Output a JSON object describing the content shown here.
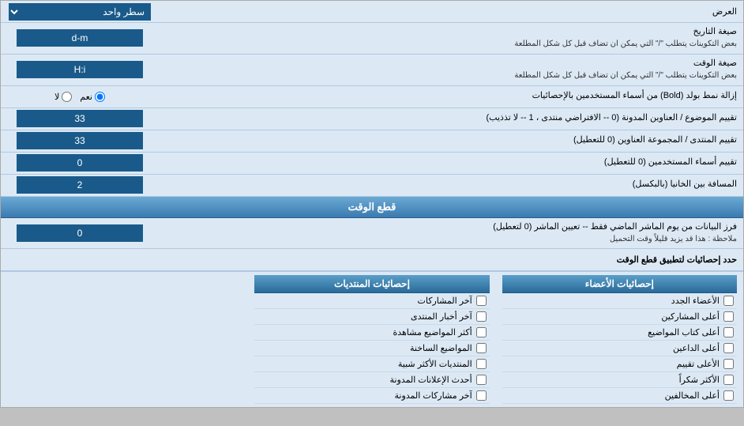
{
  "header": {
    "label": "العرض",
    "select_label": "سطر واحد"
  },
  "rows": [
    {
      "id": "date-format",
      "label": "صيغة التاريخ",
      "sublabel": "بعض التكوينات يتطلب \"/\" التي يمكن ان تضاف قبل كل شكل المطلعة",
      "value": "d-m",
      "type": "input"
    },
    {
      "id": "time-format",
      "label": "صيغة الوقت",
      "sublabel": "بعض التكوينات يتطلب \"/\" التي يمكن ان تضاف قبل كل شكل المطلعة",
      "value": "H:i",
      "type": "input"
    },
    {
      "id": "bold-names",
      "label": "إزالة نمط بولد (Bold) من أسماء المستخدمين بالإحصائيات",
      "type": "radio",
      "options": [
        "نعم",
        "لا"
      ],
      "selected": "نعم"
    },
    {
      "id": "sort-topics",
      "label": "تقييم الموضوع / العناوين المدونة (0 -- الافتراضي منتدى ، 1 -- لا تذذيب)",
      "value": "33",
      "type": "input"
    },
    {
      "id": "sort-forums",
      "label": "تقييم المنتدى / المجموعة العناوين (0 للتعطيل)",
      "value": "33",
      "type": "input"
    },
    {
      "id": "sort-users",
      "label": "تقييم أسماء المستخدمين (0 للتعطيل)",
      "value": "0",
      "type": "input"
    },
    {
      "id": "space-between",
      "label": "المسافة بين الخانيا (بالبكسل)",
      "value": "2",
      "type": "input"
    }
  ],
  "cutoff_section": {
    "title": "قطع الوقت",
    "row": {
      "label": "فرز البيانات من يوم الماشر الماضي فقط -- تعيين الماشر (0 لتعطيل)",
      "note": "ملاحظة : هذا قد يزيد قليلاً وقت التحميل",
      "value": "0"
    },
    "apply_label": "حدد إحصائيات لتطبيق قطع الوقت"
  },
  "stats": {
    "contributions_header": "إحصائيات المنتديات",
    "members_header": "إحصائيات الأعضاء",
    "contributions_items": [
      "آخر المشاركات",
      "آخر أخبار المنتدى",
      "أكثر المواضيع مشاهدة",
      "المواضيع الساخنة",
      "المنتديات الأكثر شبية",
      "أحدث الإعلانات المدونة",
      "آخر مشاركات المدونة"
    ],
    "members_items": [
      "الأعضاء الجدد",
      "أعلى المشاركين",
      "أعلى كتاب المواضيع",
      "أعلى الداعين",
      "الأعلى تقييم",
      "الأكثر شكراً",
      "أعلى المخالفين"
    ]
  }
}
